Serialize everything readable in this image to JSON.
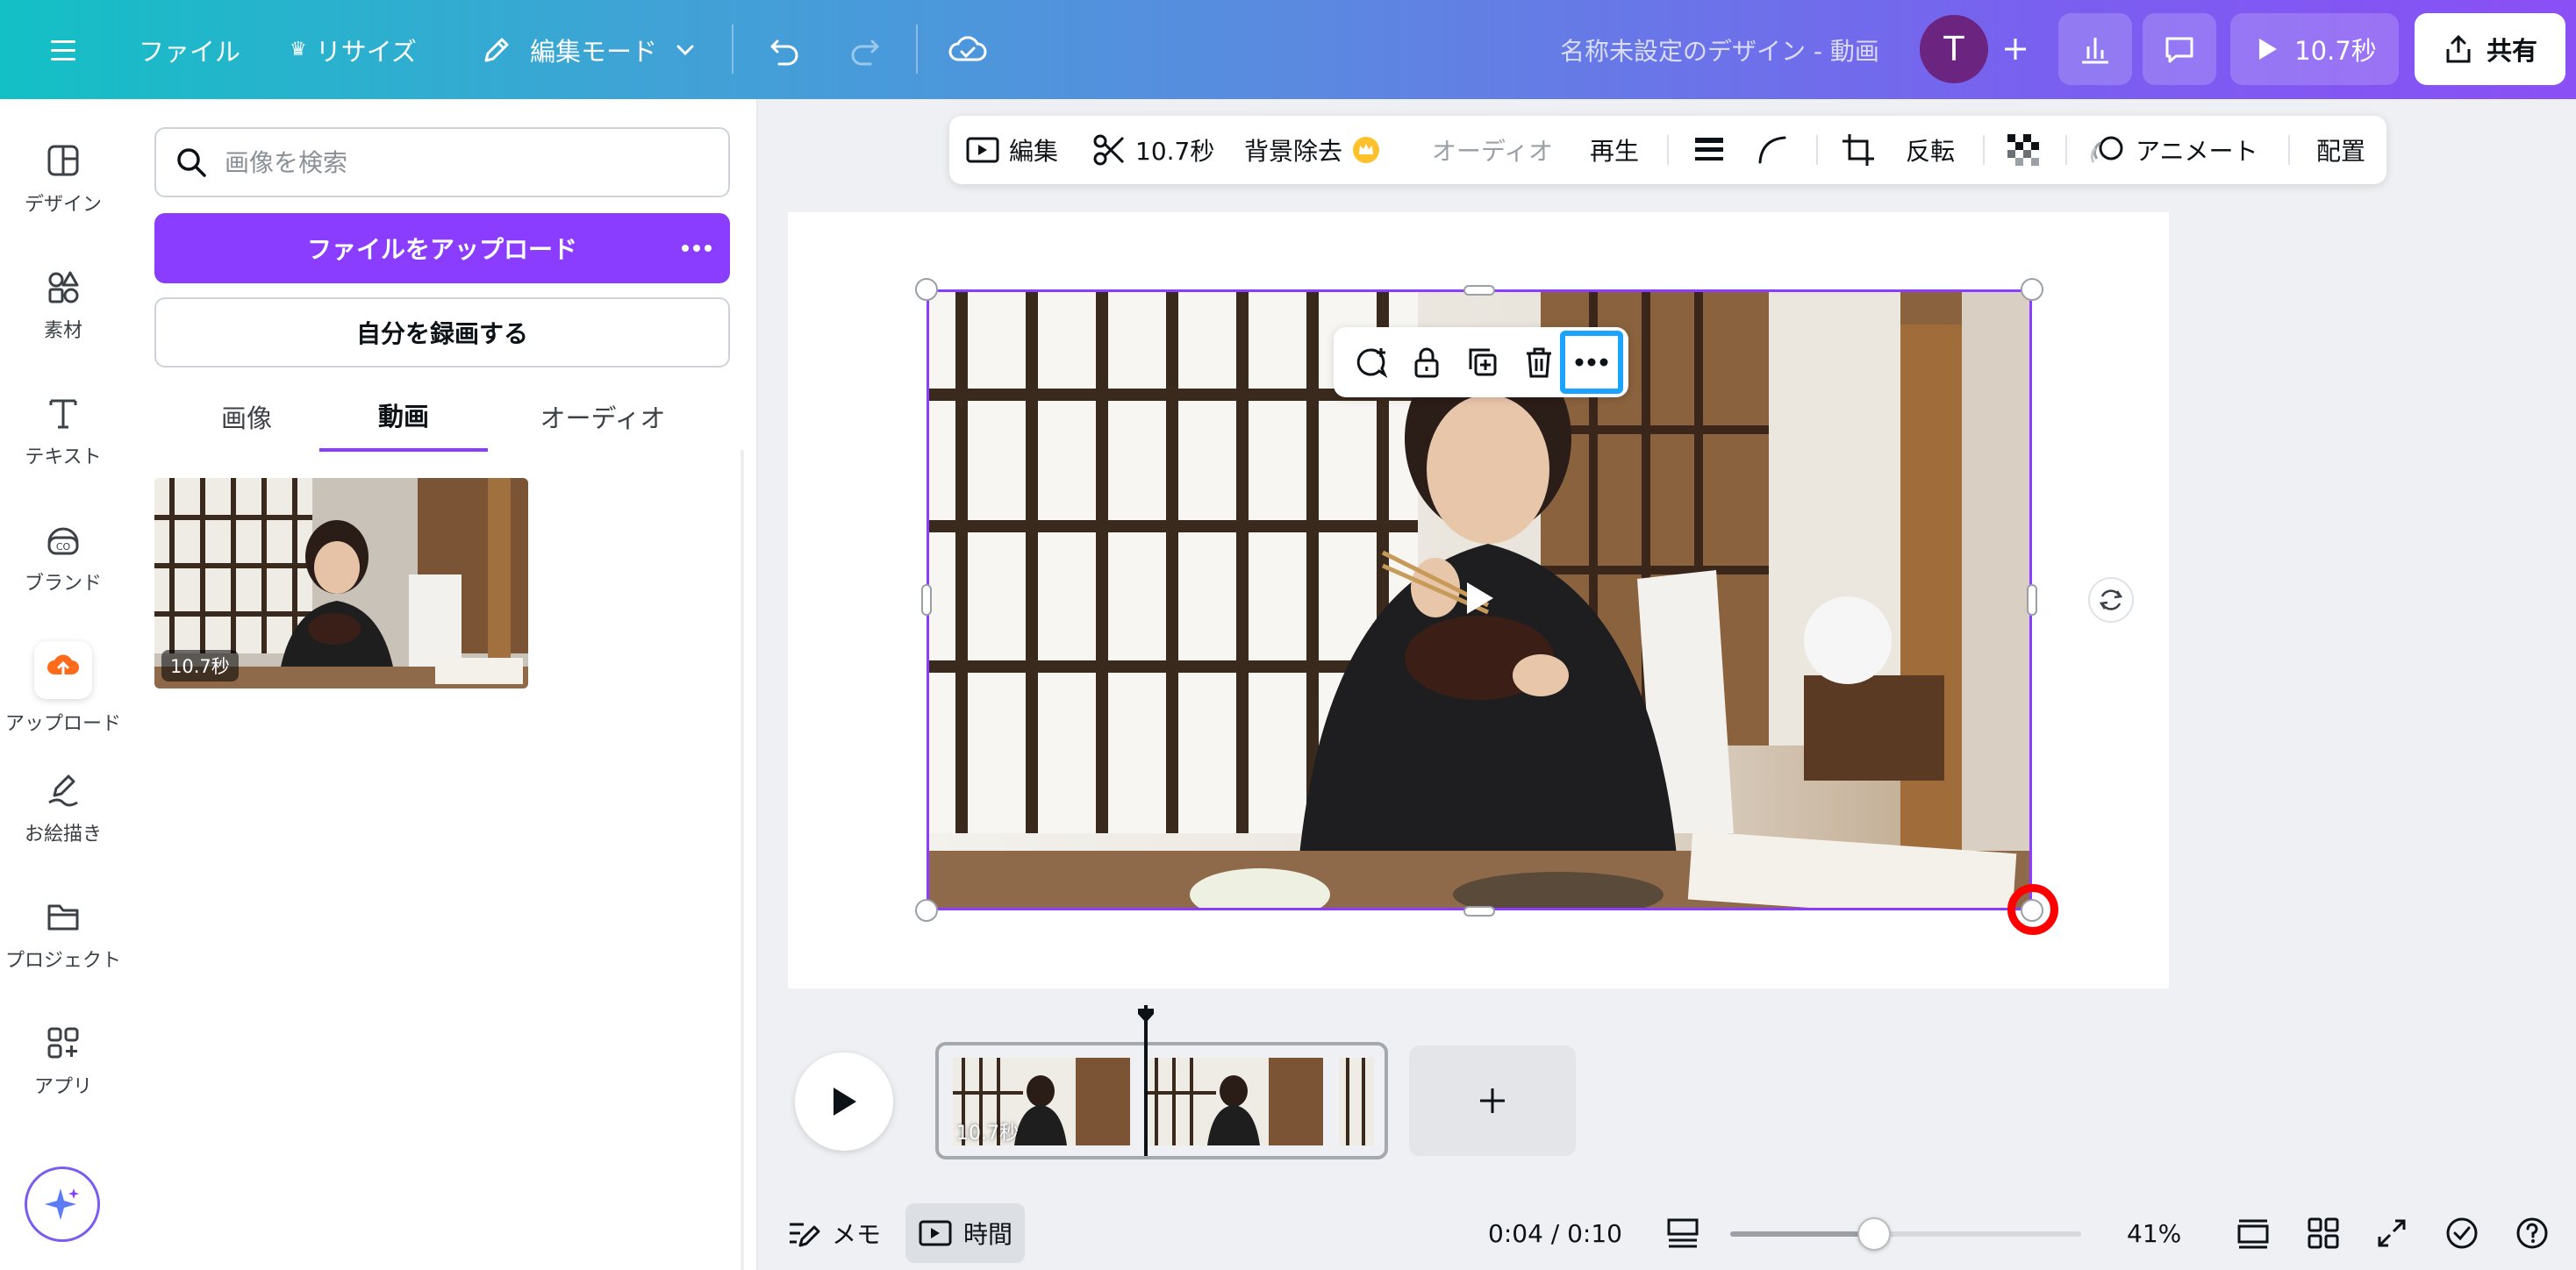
{
  "topbar": {
    "file": "ファイル",
    "resize": "リサイズ",
    "edit_mode": "編集モード",
    "doc_title": "名称未設定のデザイン - 動画",
    "avatar_initial": "T",
    "play_duration": "10.7秒",
    "share": "共有"
  },
  "rail": [
    {
      "label": "デザイン",
      "icon": "design-icon"
    },
    {
      "label": "素材",
      "icon": "elements-icon"
    },
    {
      "label": "テキスト",
      "icon": "text-icon"
    },
    {
      "label": "ブランド",
      "icon": "brand-icon"
    },
    {
      "label": "アップロード",
      "icon": "upload-icon"
    },
    {
      "label": "お絵描き",
      "icon": "draw-icon"
    },
    {
      "label": "プロジェクト",
      "icon": "folder-icon"
    },
    {
      "label": "アプリ",
      "icon": "apps-icon"
    }
  ],
  "panel": {
    "search_placeholder": "画像を検索",
    "upload_button": "ファイルをアップロード",
    "record_button": "自分を録画する",
    "tabs": [
      "画像",
      "動画",
      "オーディオ"
    ],
    "active_tab": "動画",
    "video_duration": "10.7秒"
  },
  "context_toolbar": {
    "edit": "編集",
    "duration": "10.7秒",
    "bg_remove": "背景除去",
    "audio": "オーディオ",
    "playback": "再生",
    "flip": "反転",
    "animate": "アニメート",
    "position": "配置"
  },
  "timeline": {
    "clip_duration": "10.7秒"
  },
  "bottombar": {
    "notes": "メモ",
    "time": "時間",
    "timecode": "0:04 / 0:10",
    "zoom": "41%",
    "zoom_fraction": 0.41
  },
  "colors": {
    "accent": "#8b3dff",
    "highlight_blue": "#1aa3ff",
    "annotation_red": "#ff0000"
  }
}
